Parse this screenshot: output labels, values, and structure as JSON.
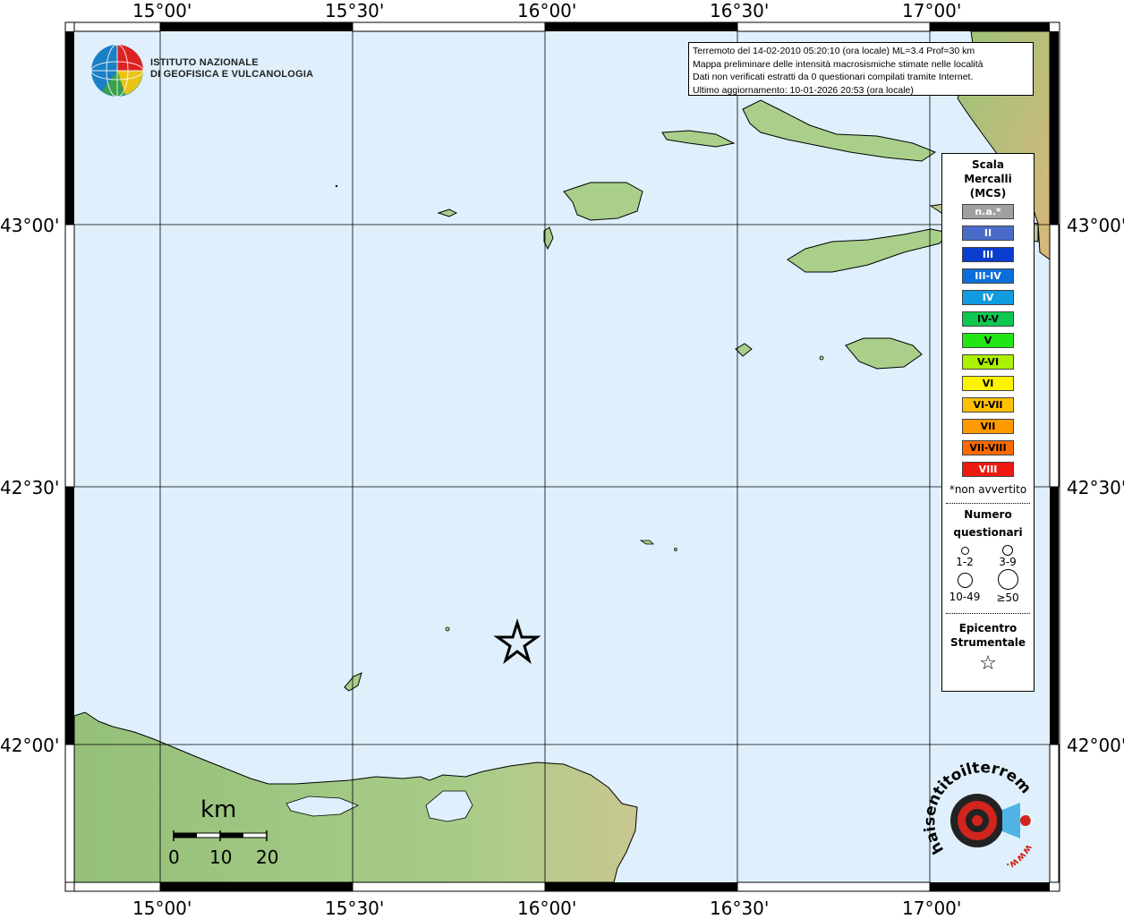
{
  "ticks": {
    "top": [
      "15°00'",
      "15°30'",
      "16°00'",
      "16°30'",
      "17°00'"
    ],
    "bottom": [
      "15°00'",
      "15°30'",
      "16°00'",
      "16°30'",
      "17°00'"
    ],
    "left": [
      "43°00'",
      "42°30'",
      "42°00'"
    ],
    "right": [
      "43°00'",
      "42°30'",
      "42°00'"
    ]
  },
  "info": {
    "line1": "Terremoto del 14-02-2010 05:20:10 (ora locale) ML=3.4 Prof=30 km",
    "line2": "Mappa preliminare delle intensità macrosismiche stimate nelle località",
    "line3": "Dati non verificati estratti da 0 questionari compilati tramite Internet.",
    "line4": "Ultimo aggiornamento: 10-01-2026 20:53 (ora locale)"
  },
  "institute": {
    "line1": "ISTITUTO NAZIONALE",
    "line2": "DI GEOFISICA E VULCANOLOGIA"
  },
  "legend": {
    "title1": "Scala",
    "title2": "Mercalli",
    "title3": "(MCS)",
    "scale": [
      {
        "label": "n.a.*",
        "color": "#a0a0a0",
        "text": "#ffffff"
      },
      {
        "label": "II",
        "color": "#4a6cc8",
        "text": "#ffffff"
      },
      {
        "label": "III",
        "color": "#0a3ccf",
        "text": "#ffffff"
      },
      {
        "label": "III-IV",
        "color": "#0a6fd8",
        "text": "#ffffff"
      },
      {
        "label": "IV",
        "color": "#119be0",
        "text": "#ffffff"
      },
      {
        "label": "IV-V",
        "color": "#10c850",
        "text": "#000000"
      },
      {
        "label": "V",
        "color": "#22e614",
        "text": "#000000"
      },
      {
        "label": "V-VI",
        "color": "#aaf000",
        "text": "#000000"
      },
      {
        "label": "VI",
        "color": "#fff400",
        "text": "#000000"
      },
      {
        "label": "VI-VII",
        "color": "#ffc000",
        "text": "#000000"
      },
      {
        "label": "VII",
        "color": "#ff9a00",
        "text": "#000000"
      },
      {
        "label": "VII-VIII",
        "color": "#ff6a00",
        "text": "#000000"
      },
      {
        "label": "VIII",
        "color": "#ee1a10",
        "text": "#ffffff"
      }
    ],
    "note": "*non avvertito",
    "count_title1": "Numero",
    "count_title2": "questionari",
    "counts": [
      "1-2",
      "3-9",
      "10-49",
      "≥50"
    ],
    "epi_title1": "Epicentro",
    "epi_title2": "Strumentale",
    "star": "☆"
  },
  "scale": {
    "unit": "km",
    "labels": [
      "0",
      "10",
      "20"
    ]
  },
  "site_logo": {
    "text": "haisentitoilterremoto.it",
    "url": "www."
  },
  "colors": {
    "sea": "#dff0fc",
    "land_low": "#8fbf75",
    "land_high": "#d8c89a",
    "grid": "#000000"
  },
  "epicenter": {
    "symbol": "star-icon"
  }
}
